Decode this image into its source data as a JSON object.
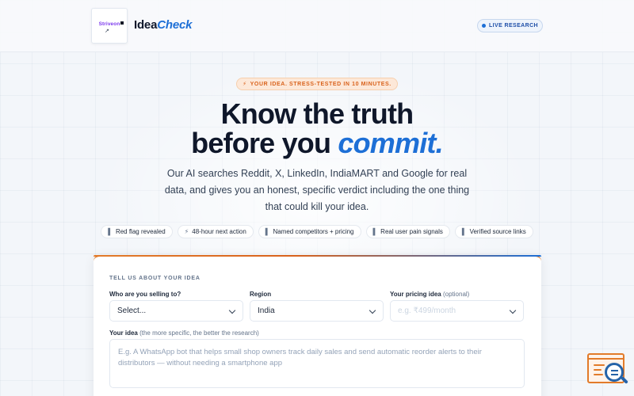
{
  "header": {
    "logo_text": "Striveon",
    "brand_main": "Idea",
    "brand_accent": "Check",
    "live_label": "LIVE RESEARCH"
  },
  "hero": {
    "pill_icon": "⚡",
    "pill_text": "YOUR IDEA. STRESS-TESTED IN 10 MINUTES.",
    "title_line1": "Know the truth",
    "title_line2_plain": "before you ",
    "title_line2_accent": "commit.",
    "subtitle": "Our AI searches Reddit, X, LinkedIn, IndiaMART and Google for real data, and gives you an honest, specific verdict including the one thing that could kill your idea."
  },
  "chips": [
    {
      "icon": "▌",
      "label": "Red flag revealed"
    },
    {
      "icon": "⚡",
      "label": "48-hour next action"
    },
    {
      "icon": "▌",
      "label": "Named competitors + pricing"
    },
    {
      "icon": "▌",
      "label": "Real user pain signals"
    },
    {
      "icon": "▌",
      "label": "Verified source links"
    }
  ],
  "form": {
    "section_title": "TELL US ABOUT YOUR IDEA",
    "selling_to": {
      "label": "Who are you selling to?",
      "value": "Select..."
    },
    "region": {
      "label": "Region",
      "value": "India"
    },
    "pricing": {
      "label": "Your pricing idea",
      "label_hint": "(optional)",
      "placeholder": "e.g. ₹499/month"
    },
    "idea": {
      "label": "Your idea",
      "label_hint": "(the more specific, the better the research)",
      "placeholder": "E.g. A WhatsApp bot that helps small shop owners track daily sales and send automatic reorder alerts to their distributors — without needing a smartphone app"
    }
  },
  "widget": {
    "icon": "document-search-icon"
  },
  "colors": {
    "accent_blue": "#1d6fd6",
    "accent_orange": "#e27b2a",
    "text_dark": "#0f172a"
  }
}
